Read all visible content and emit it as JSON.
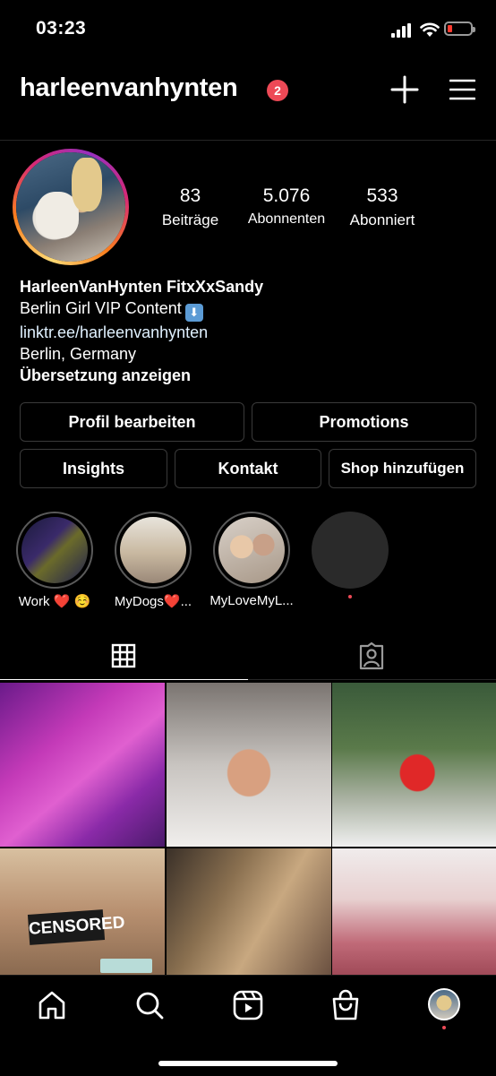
{
  "status_bar": {
    "time": "03:23"
  },
  "header": {
    "username": "harleenvanhynten",
    "notification_count": "2"
  },
  "stats": [
    {
      "value": "83",
      "label": "Beiträge"
    },
    {
      "value": "5.076",
      "label": "Abonnenten"
    },
    {
      "value": "533",
      "label": "Abonniert"
    }
  ],
  "bio": {
    "name": "HarleenVanHynten FitxXxSandy",
    "line1": "Berlin Girl VIP Content",
    "link": "linktr.ee/harleenvanhynten",
    "location": "Berlin, Germany",
    "translate": "Übersetzung anzeigen"
  },
  "buttons": {
    "edit_profile": "Profil bearbeiten",
    "promotions": "Promotions",
    "insights": "Insights",
    "contact": "Kontakt",
    "add_shop": "Shop hinzufügen"
  },
  "highlights": [
    {
      "label": "Work ❤️ ☺️"
    },
    {
      "label": "MyDogs❤️..."
    },
    {
      "label": "MyLoveMyL..."
    }
  ],
  "grid": {
    "censored_label": "CENSORED"
  },
  "colors": {
    "accent_red": "#ed4956",
    "background": "#000000",
    "button_border": "#3a3a3a"
  }
}
